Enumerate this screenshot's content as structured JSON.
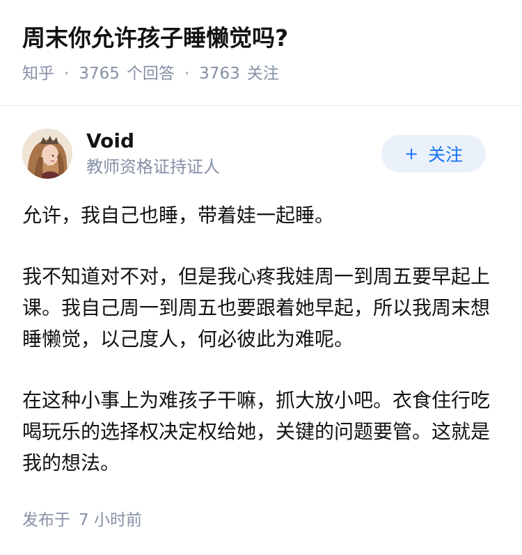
{
  "question": {
    "title": "周末你允许孩子睡懒觉吗?",
    "source": "知乎",
    "answer_count": "3765",
    "answer_label": "个回答",
    "follow_count": "3763",
    "follow_label": "关注"
  },
  "author": {
    "name": "Void",
    "badge": "教师资格证持证人",
    "avatar_icon": "avatar-portrait"
  },
  "follow_button": {
    "plus": "+",
    "label": "关注"
  },
  "answer": {
    "paragraphs": [
      "允许，我自己也睡，带着娃一起睡。",
      "我不知道对不对，但是我心疼我娃周一到周五要早起上课。我自己周一到周五也要跟着她早起，所以我周末想睡懒觉，以己度人，何必彼此为难呢。",
      "在这种小事上为难孩子干嘛，抓大放小吧。衣食住行吃喝玩乐的选择权决定权给她，关键的问题要管。这就是我的想法。"
    ]
  },
  "publish": {
    "prefix": "发布于",
    "time": "7 小时前"
  },
  "colors": {
    "accent": "#1772f6",
    "follow_bg": "#eaf1fb",
    "meta": "#8590a6",
    "text": "#121212"
  }
}
